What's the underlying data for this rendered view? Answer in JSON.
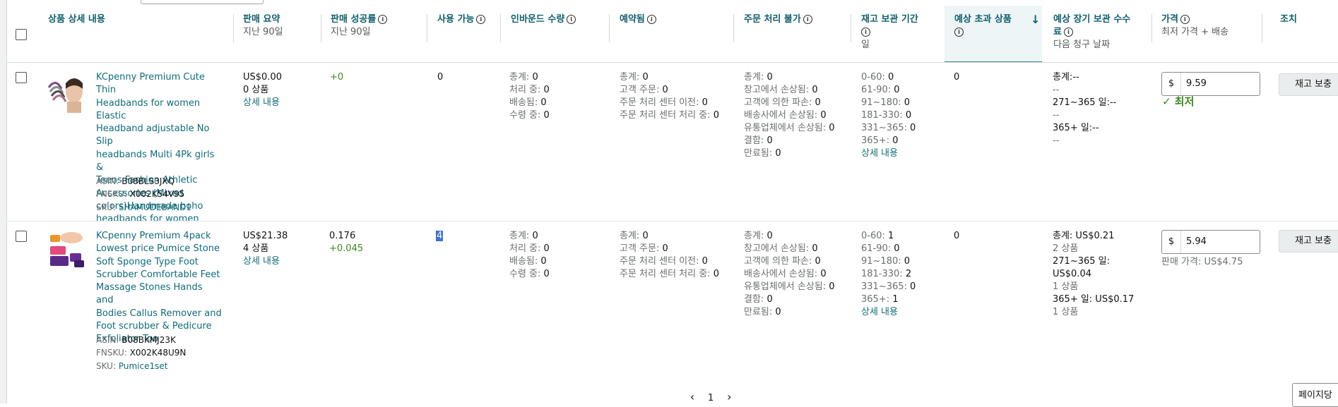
{
  "header": {
    "product_details": "상품 상세 내용",
    "sales_summary": "판매 요약",
    "sales_summary_sub": "지난 90일",
    "sell_through": "판매 성공률",
    "sell_through_sub": "지난 90일",
    "available": "사용 가능",
    "inbound": "인바운드 수량",
    "reserved": "예약됨",
    "unfulfillable": "주문 처리 불가",
    "inventory_age": "재고 보관 기간",
    "inventory_age_sub": "일",
    "estimated_excess": "예상 초과 상품",
    "ltsf_line1": "예상 장기 보관 수수",
    "ltsf_line2": "료",
    "ltsf_sub": "다음 청구 날짜",
    "price": "가격",
    "price_sub": "최저 가격 + 배송",
    "action": "조치",
    "info_glyph": "i",
    "sort_glyph": "↓"
  },
  "rows": [
    {
      "title_lines": [
        "KCpenny Premium Cute Thin",
        "Headbands for women Elastic",
        "Headband adjustable No Slip",
        "headbands Multi 4Pk girls &",
        "Teens Fashion Athletic",
        "Accessories (Mixed",
        "colors)Handmade boho",
        "headbands for women"
      ],
      "asin_label": "ASIN:",
      "asin": "B08BLS3JXQ",
      "fnsku_label": "FNSKU:",
      "fnsku": "X002K54V95",
      "sku_label": "SKU:",
      "sku": "SHAMUDEBAND1",
      "sales": "US$0.00",
      "units": "0 상품",
      "details_link": "상세 내용",
      "sell_through_main": "+0",
      "sell_through_delta": "",
      "available": "0",
      "inbound": [
        [
          "총계:",
          "0"
        ],
        [
          "처리 중:",
          "0"
        ],
        [
          "배송됨:",
          "0"
        ],
        [
          "수령 중:",
          "0"
        ]
      ],
      "reserved": [
        [
          "총계:",
          "0"
        ],
        [
          "고객 주문:",
          "0"
        ],
        [
          "주문 처리 센터 이전:",
          "0"
        ],
        [
          "주문 처리 센터 처리 중:",
          "0"
        ]
      ],
      "unfulfillable": [
        [
          "총계:",
          "0"
        ],
        [
          "창고에서 손상됨:",
          "0"
        ],
        [
          "고객에 의한 파손:",
          "0"
        ],
        [
          "배송사에서 손상됨:",
          "0"
        ],
        [
          "유통업체에서 손상됨:",
          "0"
        ],
        [
          "결함:",
          "0"
        ],
        [
          "만료됨:",
          "0"
        ]
      ],
      "age": [
        [
          "0-60:",
          "0"
        ],
        [
          "61-90:",
          "0"
        ],
        [
          "91~180:",
          "0"
        ],
        [
          "181-330:",
          "0"
        ],
        [
          "331~365:",
          "0"
        ],
        [
          "365+:",
          "0"
        ]
      ],
      "age_details": "상세 내용",
      "excess": "0",
      "ltsf": [
        "총계:--",
        "--",
        "271~365 일:--",
        "--",
        "365+ 일:--",
        "--"
      ],
      "currency": "$",
      "price": "9.59",
      "price_note": "✓ 최저",
      "action_label": "재고 보충"
    },
    {
      "title_lines": [
        "KCpenny Premium 4pack",
        "Lowest price Pumice Stone",
        "Soft Sponge Type Foot",
        "Scrubber Comfortable Feet",
        "Massage Stones Hands and",
        "Bodies Callus Remover and",
        "Foot scrubber & Pedicure",
        "Exfoliator Too"
      ],
      "asin_label": "ASIN:",
      "asin": "B08BKMJ23K",
      "fnsku_label": "FNSKU:",
      "fnsku": "X002K48U9N",
      "sku_label": "SKU:",
      "sku": "Pumice1set",
      "sales": "US$21.38",
      "units": "4 상품",
      "details_link": "상세 내용",
      "sell_through_main": "0.176",
      "sell_through_delta": "+0.045",
      "available": "4",
      "inbound": [
        [
          "총계:",
          "0"
        ],
        [
          "처리 중:",
          "0"
        ],
        [
          "배송됨:",
          "0"
        ],
        [
          "수령 중:",
          "0"
        ]
      ],
      "reserved": [
        [
          "총계:",
          "0"
        ],
        [
          "고객 주문:",
          "0"
        ],
        [
          "주문 처리 센터 이전:",
          "0"
        ],
        [
          "주문 처리 센터 처리 중:",
          "0"
        ]
      ],
      "unfulfillable": [
        [
          "총계:",
          "0"
        ],
        [
          "창고에서 손상됨:",
          "0"
        ],
        [
          "고객에 의한 파손:",
          "0"
        ],
        [
          "배송사에서 손상됨:",
          "0"
        ],
        [
          "유통업체에서 손상됨:",
          "0"
        ],
        [
          "결함:",
          "0"
        ],
        [
          "만료됨:",
          "0"
        ]
      ],
      "age": [
        [
          "0-60:",
          "1"
        ],
        [
          "61-90:",
          "0"
        ],
        [
          "91~180:",
          "0"
        ],
        [
          "181-330:",
          "2"
        ],
        [
          "331~365:",
          "0"
        ],
        [
          "365+:",
          "1"
        ]
      ],
      "age_details": "상세 내용",
      "excess": "0",
      "ltsf": [
        "총계: US$0.21",
        "2 상품",
        "271~365 일:",
        "US$0.04",
        "1 상품",
        "365+ 일: US$0.17",
        "1 상품"
      ],
      "currency": "$",
      "price": "5.94",
      "price_note": "판매 가격: US$4.75",
      "action_label": "재고 보충"
    }
  ],
  "pagination": {
    "prev": "‹",
    "page": "1",
    "next": "›",
    "page_size_label": "페이지당"
  },
  "colors": {
    "link": "#0f6c7a",
    "header_text": "#0f5f6b",
    "positive": "#3a8a1f",
    "selected_col_bg": "#eef5f6"
  }
}
